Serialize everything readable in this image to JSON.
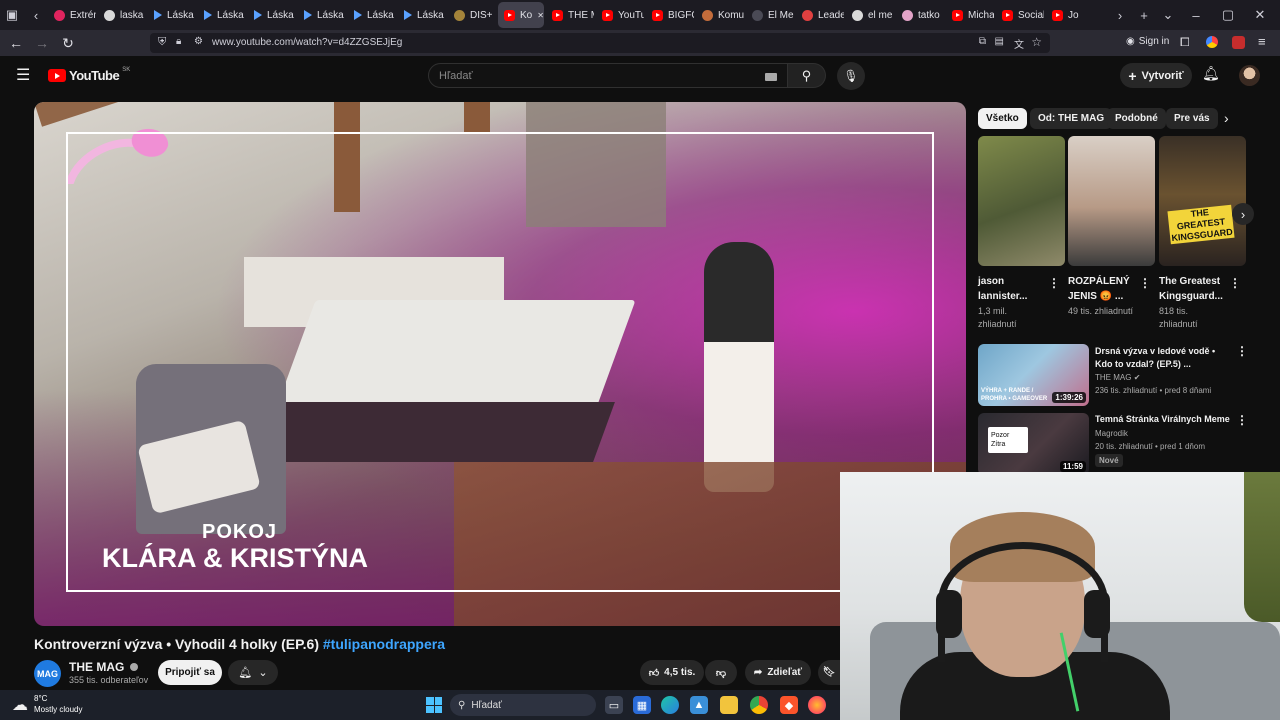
{
  "browser": {
    "tabs": [
      {
        "label": "Extrém"
      },
      {
        "label": "laska"
      },
      {
        "label": "Láska"
      },
      {
        "label": "Láska"
      },
      {
        "label": "Láska"
      },
      {
        "label": "Láska"
      },
      {
        "label": "Láska"
      },
      {
        "label": "Láska"
      },
      {
        "label": "DIS+"
      },
      {
        "label": "Ko",
        "active": true
      },
      {
        "label": "THE M"
      },
      {
        "label": "YouTu"
      },
      {
        "label": "BIGFO"
      },
      {
        "label": "Komu"
      },
      {
        "label": "El Mencho"
      },
      {
        "label": "Leade"
      },
      {
        "label": "el me"
      },
      {
        "label": "tatko"
      },
      {
        "label": "Micha"
      },
      {
        "label": "Social"
      },
      {
        "label": "Jo"
      }
    ],
    "url": "www.youtube.com/watch?v=d4ZZGSEJjEg",
    "signin_label": "Sign in"
  },
  "youtube": {
    "logo_text": "YouTube",
    "region": "SK",
    "search_placeholder": "Hľadať",
    "create_label": "Vytvoriť",
    "video": {
      "overlay_sub": "POKOJ",
      "overlay_title": "KLÁRA & KRISTÝNA",
      "title": "Kontroverzní výzva • Vyhodil 4 holky (EP.6) ",
      "hashtag": "#tulipanodrappera",
      "channel": "THE MAG",
      "channel_logo": "MAG",
      "subscribers": "355 tis. odberateľov",
      "join_label": "Pripojiť sa",
      "likes": "4,5 tis.",
      "share_label": "Zdieľať"
    },
    "chips": [
      "Všetko",
      "Od: THE MAG",
      "Podobné",
      "Pre vás"
    ],
    "shorts": [
      {
        "title": "jason lannister...",
        "views": "1,3 mil. zhliadnutí",
        "thumb_text": ""
      },
      {
        "title": "ROZPÁLENÝ JENIS 😡 ...",
        "views": "49 tis. zhliadnutí",
        "thumb_text": ""
      },
      {
        "title": "The Greatest Kingsguard...",
        "views": "818 tis. zhliadnutí",
        "thumb_text": "THE GREATEST KINGSGUARD"
      }
    ],
    "related": [
      {
        "title": "Drsná výzva v ledové vodě • Kdo to vzdal? (EP.5) ...",
        "channel": "THE MAG",
        "meta": "236 tis. zhliadnutí • pred 8 dňami",
        "duration": "1:39:26",
        "thumb_text": "VÝHRA + RANDE / PROHRA • GAMEOVER"
      },
      {
        "title": "Temná Stránka Virálnych Meme",
        "channel": "Magrodik",
        "meta": "20 tis. zhliadnutí • pred 1 dňom",
        "duration": "11:59",
        "badge": "Nové",
        "thumb_text": "Pozor Zítra"
      }
    ]
  },
  "taskbar": {
    "temperature": "8°C",
    "condition": "Mostly cloudy",
    "search_placeholder": "Hľadať"
  }
}
